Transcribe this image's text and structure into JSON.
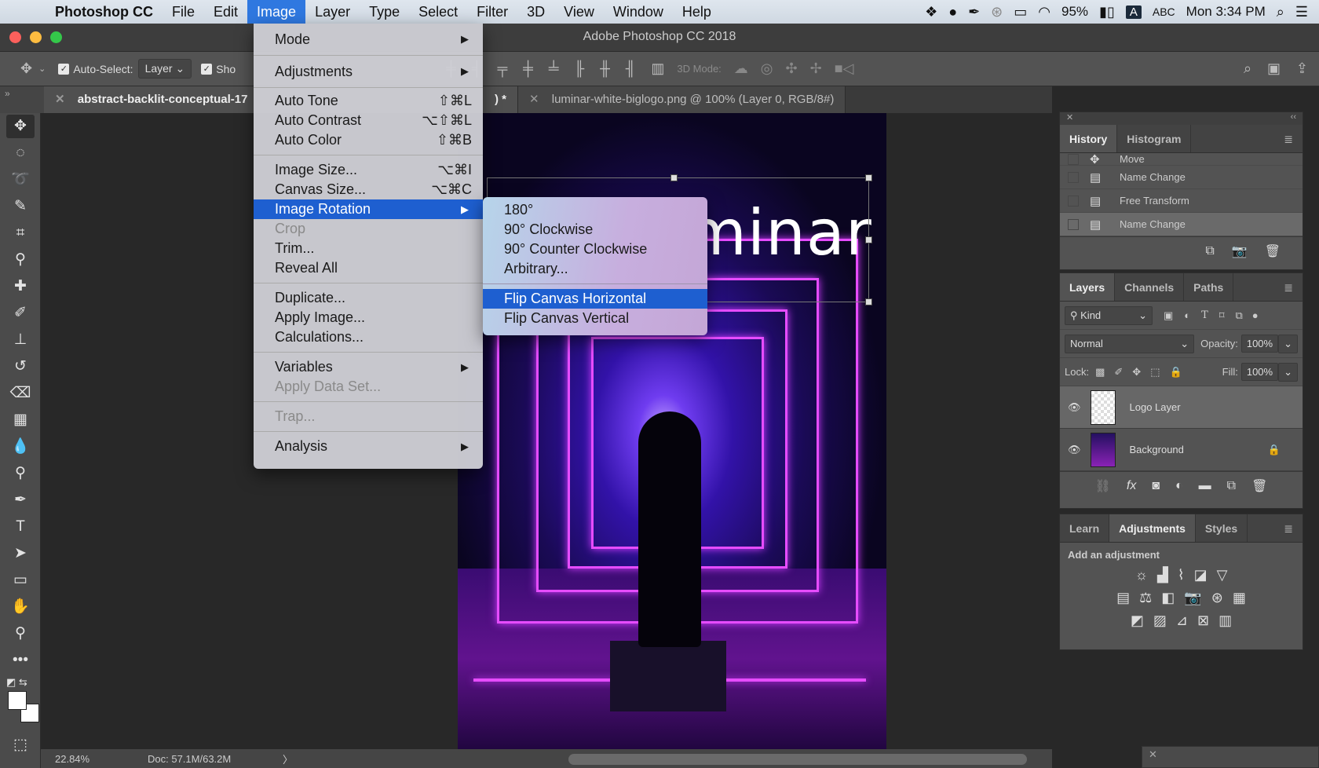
{
  "menubar": {
    "apple_icon": "apple-icon",
    "app_name": "Photoshop CC",
    "items": [
      "File",
      "Edit",
      "Image",
      "Layer",
      "Type",
      "Select",
      "Filter",
      "3D",
      "View",
      "Window",
      "Help"
    ],
    "active_item": "Image",
    "status": {
      "battery": "95%",
      "input_label": "A",
      "input_source": "ABC",
      "clock": "Mon 3:34 PM"
    }
  },
  "window": {
    "title": "Adobe Photoshop CC 2018"
  },
  "options_bar": {
    "auto_select_label": "Auto-Select:",
    "auto_select_value": "Layer",
    "show_transform_label": "Sho",
    "mode_3d_label": "3D Mode:"
  },
  "tabs": [
    {
      "label": "abstract-backlit-conceptual-17",
      "suffix": ") *",
      "active": true
    },
    {
      "label": "luminar-white-biglogo.png @ 100% (Layer 0, RGB/8#)",
      "active": false
    }
  ],
  "left_strip": {
    "expand": "»"
  },
  "image_menu": {
    "groups": [
      [
        {
          "label": "Mode",
          "submenu": true
        }
      ],
      [
        {
          "label": "Adjustments",
          "submenu": true
        }
      ],
      [
        {
          "label": "Auto Tone",
          "shortcut": "⇧⌘L"
        },
        {
          "label": "Auto Contrast",
          "shortcut": "⌥⇧⌘L"
        },
        {
          "label": "Auto Color",
          "shortcut": "⇧⌘B"
        }
      ],
      [
        {
          "label": "Image Size...",
          "shortcut": "⌥⌘I"
        },
        {
          "label": "Canvas Size...",
          "shortcut": "⌥⌘C"
        },
        {
          "label": "Image Rotation",
          "submenu": true,
          "highlighted": true
        },
        {
          "label": "Crop",
          "disabled": true
        },
        {
          "label": "Trim..."
        },
        {
          "label": "Reveal All"
        }
      ],
      [
        {
          "label": "Duplicate..."
        },
        {
          "label": "Apply Image..."
        },
        {
          "label": "Calculations..."
        }
      ],
      [
        {
          "label": "Variables",
          "submenu": true
        },
        {
          "label": "Apply Data Set...",
          "disabled": true
        }
      ],
      [
        {
          "label": "Trap...",
          "disabled": true
        }
      ],
      [
        {
          "label": "Analysis",
          "submenu": true
        }
      ]
    ]
  },
  "rotation_submenu": {
    "items": [
      "180°",
      "90° Clockwise",
      "90° Counter Clockwise",
      "Arbitrary..."
    ],
    "flip_items": [
      "Flip Canvas Horizontal",
      "Flip Canvas Vertical"
    ],
    "highlighted": "Flip Canvas Horizontal"
  },
  "canvas": {
    "logo_text": "minar"
  },
  "status_bar": {
    "zoom": "22.84%",
    "doc_size": "Doc: 57.1M/63.2M",
    "arrow": "〉"
  },
  "history_panel": {
    "tabs": [
      "History",
      "Histogram"
    ],
    "active_tab": "History",
    "items": [
      {
        "label": "Move",
        "icon": "move-icon"
      },
      {
        "label": "Name Change",
        "icon": "document-icon"
      },
      {
        "label": "Free Transform",
        "icon": "document-icon"
      },
      {
        "label": "Name Change",
        "icon": "document-icon",
        "selected": true
      }
    ]
  },
  "layers_panel": {
    "tabs": [
      "Layers",
      "Channels",
      "Paths"
    ],
    "active_tab": "Layers",
    "filter_kind": "Kind",
    "blend_mode": "Normal",
    "opacity_label": "Opacity:",
    "opacity": "100%",
    "lock_label": "Lock:",
    "fill_label": "Fill:",
    "fill": "100%",
    "layers": [
      {
        "name": "Logo Layer",
        "visible": true,
        "selected": true,
        "locked": false
      },
      {
        "name": "Background",
        "visible": true,
        "selected": false,
        "locked": true
      }
    ]
  },
  "adjustments_panel": {
    "tabs": [
      "Learn",
      "Adjustments",
      "Styles"
    ],
    "active_tab": "Adjustments",
    "heading": "Add an adjustment"
  },
  "icons": {
    "panel_menu": "≣",
    "close": "✕",
    "collapse": "‹‹",
    "submenu_arrow": "▶",
    "eye": "👁",
    "lock": "🔒",
    "check": "✓"
  }
}
